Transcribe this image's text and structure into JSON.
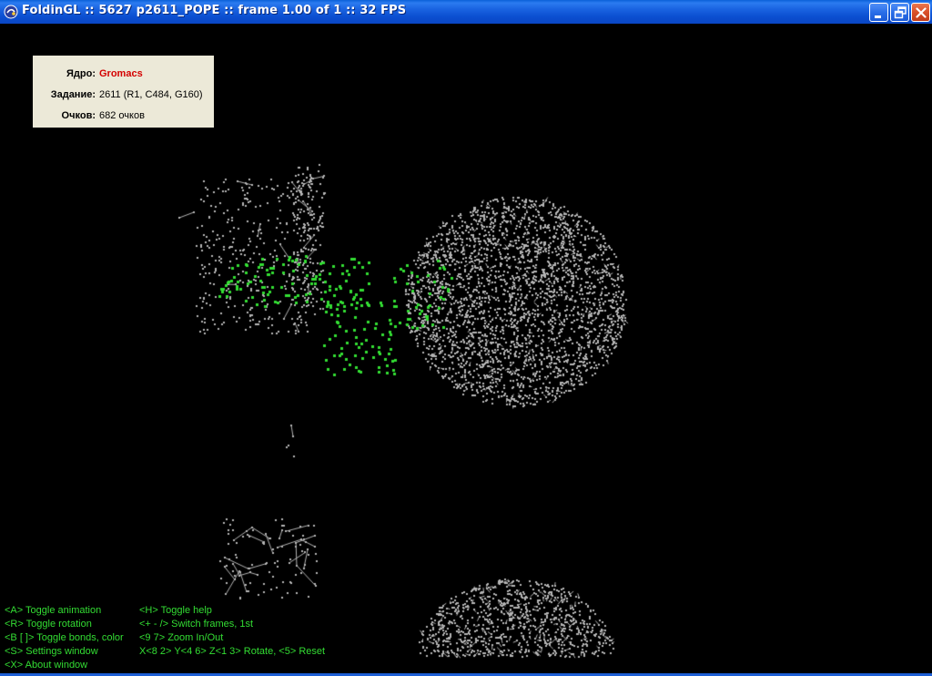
{
  "window": {
    "title": "FoldinGL :: 5627 p2611_POPE :: frame 1.00 of 1 :: 32 FPS",
    "controls": [
      "minimize",
      "restore",
      "close"
    ]
  },
  "info": {
    "core_label": "Ядро:",
    "core_value": "Gromacs",
    "task_label": "Задание:",
    "task_value": "2611 (R1, C484, G160)",
    "points_label": "Очков:",
    "points_value": "682 очков"
  },
  "help": {
    "left": [
      "<A> Toggle animation",
      "<R> Toggle rotation",
      "<B [ ]> Toggle bonds, color",
      "<S> Settings window",
      "<X> About window"
    ],
    "right": [
      "<H> Toggle help",
      "<+ - /> Switch frames, 1st",
      "<9 7> Zoom In/Out",
      "X<8 2> Y<4 6> Z<1 3> Rotate, <5> Reset"
    ]
  },
  "colors": {
    "background": "#000000",
    "atom": "#b4b4b4",
    "ligand": "#33dd33",
    "help_text": "#33dd33",
    "core_value": "#d40000",
    "titlebar": "#0b4fd1"
  },
  "icons": [
    "foldinggl-app-icon",
    "minimize-icon",
    "restore-icon",
    "close-icon"
  ]
}
